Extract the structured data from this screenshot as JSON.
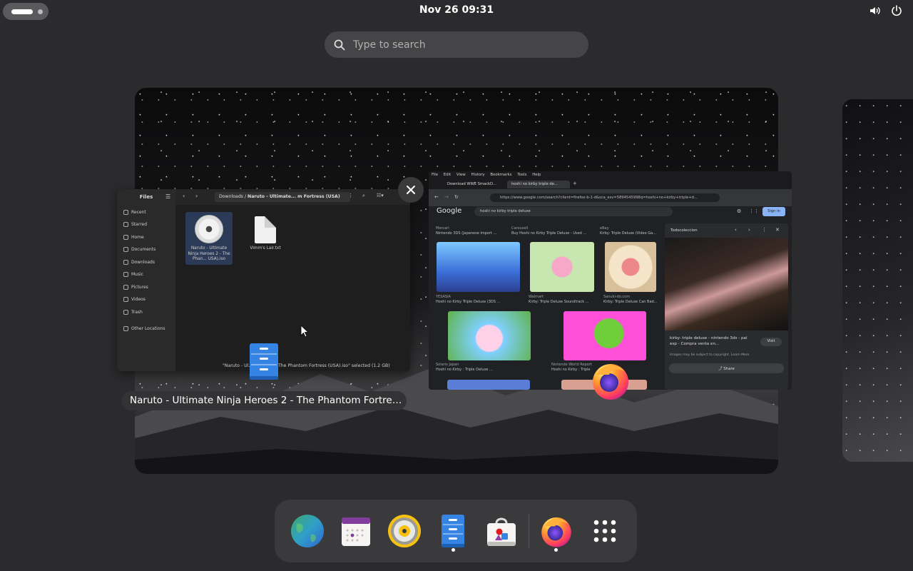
{
  "topbar": {
    "clock": "Nov 26  09:31",
    "tray_icons": [
      "volume-icon",
      "power-icon"
    ]
  },
  "search": {
    "placeholder": "Type to search"
  },
  "window_title": "Naruto - Ultimate Ninja Heroes 2 - The Phantom Fortre…",
  "files_window": {
    "title": "Files",
    "sidebar": [
      {
        "icon": "clock-icon",
        "label": "Recent"
      },
      {
        "icon": "star-icon",
        "label": "Starred"
      },
      {
        "icon": "home-icon",
        "label": "Home"
      },
      {
        "icon": "document-icon",
        "label": "Documents"
      },
      {
        "icon": "download-icon",
        "label": "Downloads"
      },
      {
        "icon": "music-icon",
        "label": "Music"
      },
      {
        "icon": "picture-icon",
        "label": "Pictures"
      },
      {
        "icon": "video-icon",
        "label": "Videos"
      },
      {
        "icon": "trash-icon",
        "label": "Trash"
      },
      {
        "icon": "plus-icon",
        "label": "Other Locations"
      }
    ],
    "path": {
      "parent": "Downloads",
      "separator": "/",
      "current": "Naruto - Ultimate... m Fortress (USA)"
    },
    "files": [
      {
        "name": "Naruto - Ultimate Ninja Heroes 2 - The Phan... USA).iso",
        "type": "disc-image"
      },
      {
        "name": "Vimm's Lair.txt",
        "type": "text"
      }
    ],
    "status": "\"Naruto - Ul... Heroes 2 - The Phantom Fortress (USA).iso\" selected (1.2 GB)"
  },
  "browser_window": {
    "menu": [
      "File",
      "Edit",
      "View",
      "History",
      "Bookmarks",
      "Tools",
      "Help"
    ],
    "tabs": [
      {
        "label": "Download WWE SmackD...",
        "active": false
      },
      {
        "label": "hoshi no kirby triple de...",
        "active": true
      }
    ],
    "url": "https://www.google.com/search?client=firefox-b-1-d&sca_esv=5894545998q=hoshi+no+kirby+triple+d...",
    "google": {
      "logo": "Google",
      "query": "hoshi no kirby triple deluxe",
      "signin": "Sign in"
    },
    "results": [
      {
        "source": "Mercari",
        "caption": "Nintendo 3DS (Japanese Import ..."
      },
      {
        "source": "Carousell",
        "caption": "Buy Hoshi no Kirby Triple Deluxe - Used ..."
      },
      {
        "source": "eBay",
        "caption": "Kirby: Triple Deluxe (Video Ga..."
      },
      {
        "source": "YESASIA",
        "caption": "Hoshi no Kirby Triple Deluxe (3DS ..."
      },
      {
        "source": "Walmart",
        "caption": "Kirby: Triple Deluxe Soundtrack ..."
      },
      {
        "source": "Sanuki-do.com",
        "caption": "Kirby: Triple Deluxe Can Bad..."
      },
      {
        "source": "Solaris Japan",
        "caption": "Hoshi no Kirby : Triple Deluxe ..."
      },
      {
        "source": "Nintendo World Report",
        "caption": "Hoshi no Kirby : Triple ..."
      }
    ],
    "side_panel": {
      "source": "Todocoleccion",
      "title": "kirby: triple deluxe - nintendo 3ds - pal esp - Compra venta en...",
      "note": "Images may be subject to copyright. Learn More",
      "visit": "Visit",
      "share": "Share"
    }
  },
  "dock": {
    "items": [
      {
        "name": "browser-globe-icon",
        "running": false
      },
      {
        "name": "calendar-icon",
        "running": false
      },
      {
        "name": "rhythmbox-icon",
        "running": false
      },
      {
        "name": "files-icon",
        "running": true
      },
      {
        "name": "software-store-icon",
        "running": false
      },
      {
        "name": "firefox-icon",
        "running": true
      },
      {
        "name": "app-grid-icon",
        "running": false
      }
    ]
  },
  "colors": {
    "background": "#2b2b2d",
    "dock": "#3a3a3c",
    "search": "#454547",
    "accent_blue": "#3584e4"
  }
}
